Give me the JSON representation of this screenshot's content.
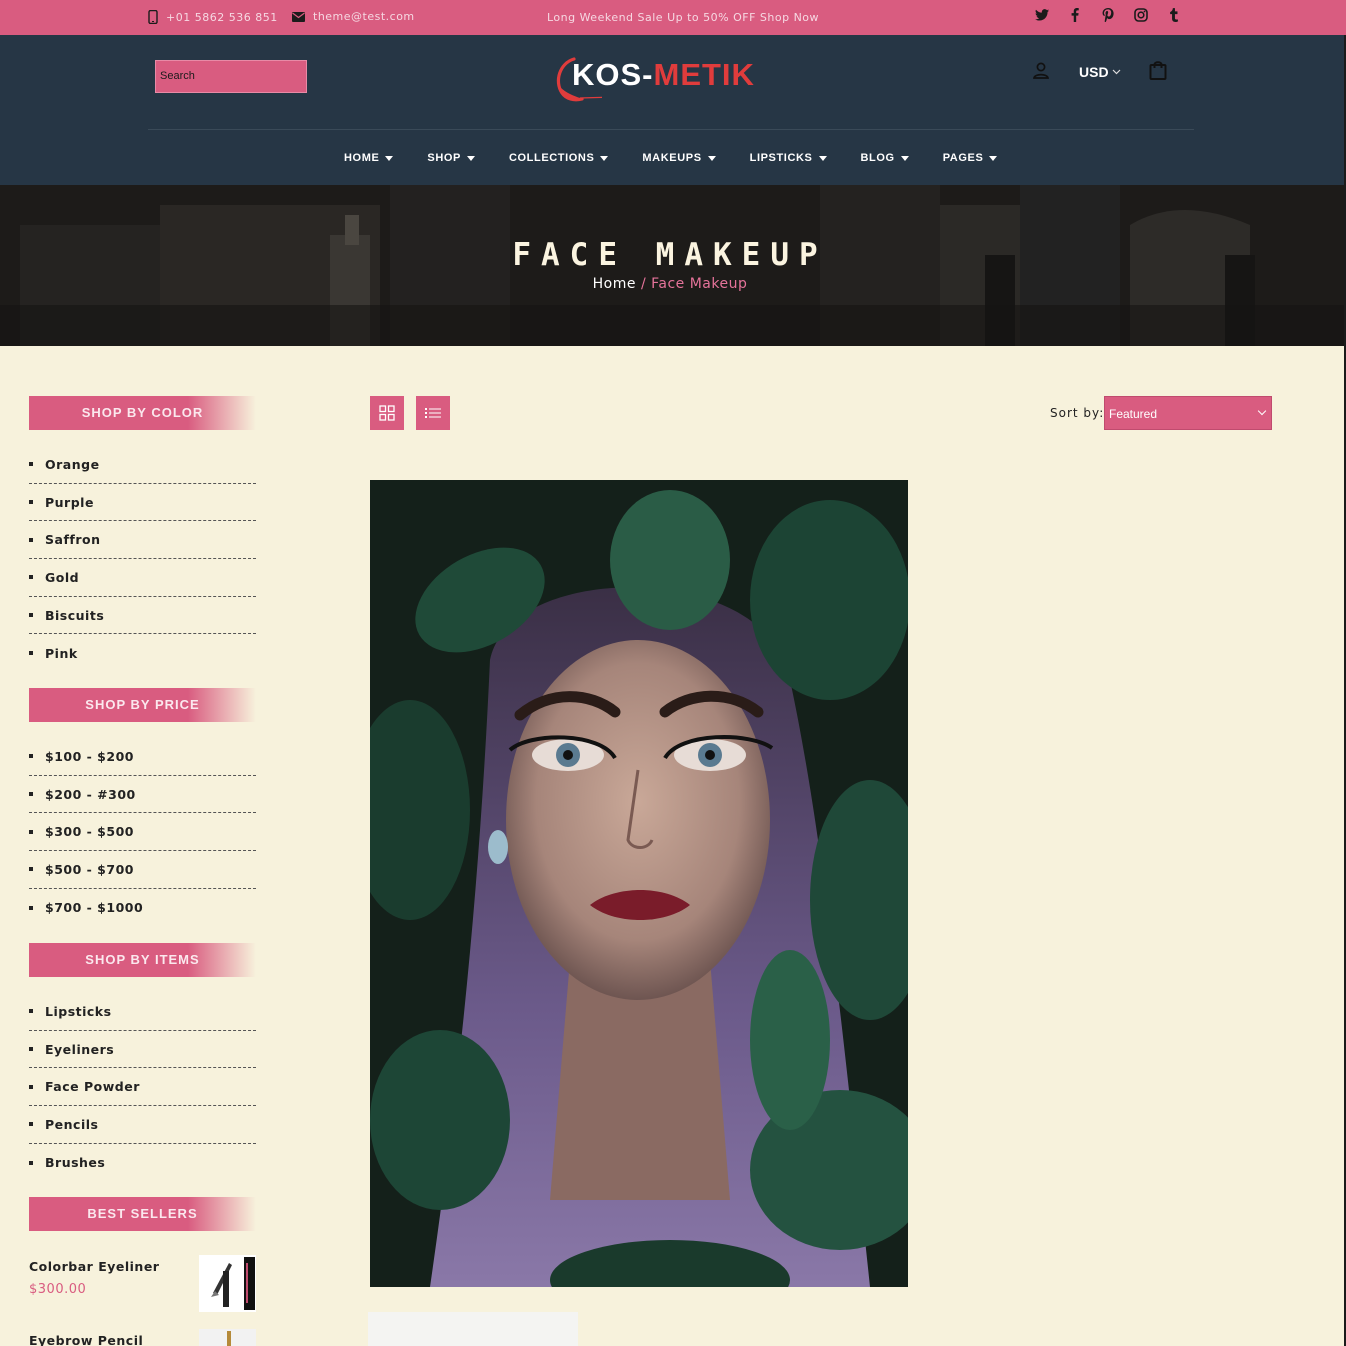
{
  "topbar": {
    "phone": "+01 5862 536 851",
    "email": "theme@test.com",
    "promo": "Long Weekend Sale Up to 50% OFF Shop Now",
    "social": [
      "twitter-icon",
      "facebook-icon",
      "pinterest-icon",
      "instagram-icon",
      "tumblr-icon"
    ]
  },
  "header": {
    "search_placeholder": "Search",
    "logo_main": "KOS-",
    "logo_accent": "METIK",
    "currency": "USD",
    "nav": [
      "HOME",
      "SHOP",
      "COLLECTIONS",
      "MAKEUPS",
      "LIPSTICKS",
      "BLOG",
      "PAGES"
    ]
  },
  "banner": {
    "title": "FACE MAKEUP",
    "crumb_home": "Home",
    "crumb_sep": "/",
    "crumb_current": "Face Makeup"
  },
  "sidebar": {
    "color": {
      "title": "SHOP BY COLOR",
      "items": [
        "Orange",
        "Purple",
        "Saffron",
        "Gold",
        "Biscuits",
        "Pink"
      ]
    },
    "price": {
      "title": "SHOP BY PRICE",
      "items": [
        "$100 - $200",
        "$200 - #300",
        "$300 - $500",
        "$500 - $700",
        "$700 - $1000"
      ]
    },
    "items": {
      "title": "SHOP BY ITEMS",
      "items": [
        "Lipsticks",
        "Eyeliners",
        "Face Powder",
        "Pencils",
        "Brushes"
      ]
    },
    "best_sellers": {
      "title": "BEST SELLERS",
      "products": [
        {
          "name": "Colorbar Eyeliner",
          "price": "$300.00"
        },
        {
          "name": "Eyebrow Pencil",
          "price": ""
        }
      ]
    }
  },
  "toolbar": {
    "sort_label": "Sort by:",
    "sort_value": "Featured"
  },
  "colors": {
    "accent": "#d95c80",
    "header_bg": "#263645",
    "page_bg": "#f7f2dc"
  }
}
